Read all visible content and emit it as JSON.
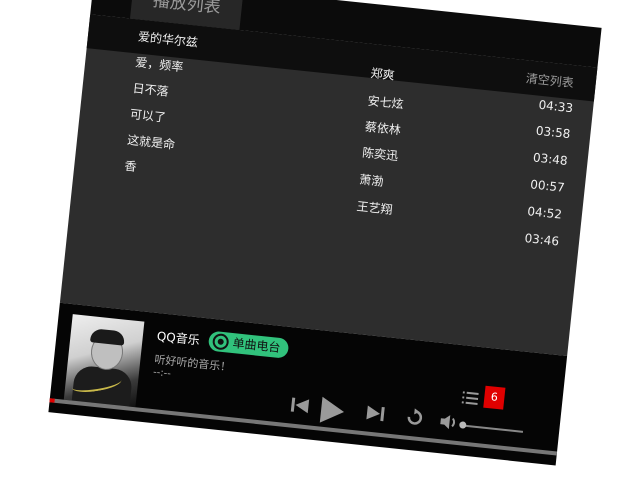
{
  "playlist": {
    "tab_label": "播放列表",
    "clear_label": "清空列表",
    "songs": [
      {
        "title": "爱的华尔兹",
        "artist": "郑爽",
        "duration": "04:33"
      },
      {
        "title": "爱，频率",
        "artist": "安七炫",
        "duration": "03:58"
      },
      {
        "title": "日不落",
        "artist": "蔡依林",
        "duration": "03:48"
      },
      {
        "title": "可以了",
        "artist": "陈奕迅",
        "duration": "00:57"
      },
      {
        "title": "这就是命",
        "artist": "萧渤",
        "duration": "04:52"
      },
      {
        "title": "香",
        "artist": "王艺翔",
        "duration": "03:46"
      }
    ]
  },
  "player": {
    "app_name": "QQ音乐",
    "radio_badge": "单曲电台",
    "slogan": "听好听的音乐！",
    "time_display": "--:--",
    "queue_count": "6",
    "progress_fraction": 0.0,
    "volume_fraction": 0.0
  },
  "icons": [
    "album-cover",
    "radio-icon",
    "prev-icon",
    "play-icon",
    "next-icon",
    "repeat-icon",
    "volume-icon",
    "playlist-icon"
  ],
  "colors": {
    "accent_green": "#31c27c",
    "accent_red": "#e00000",
    "panel_dark": "#2d2d2d",
    "bar_black": "#050505"
  }
}
